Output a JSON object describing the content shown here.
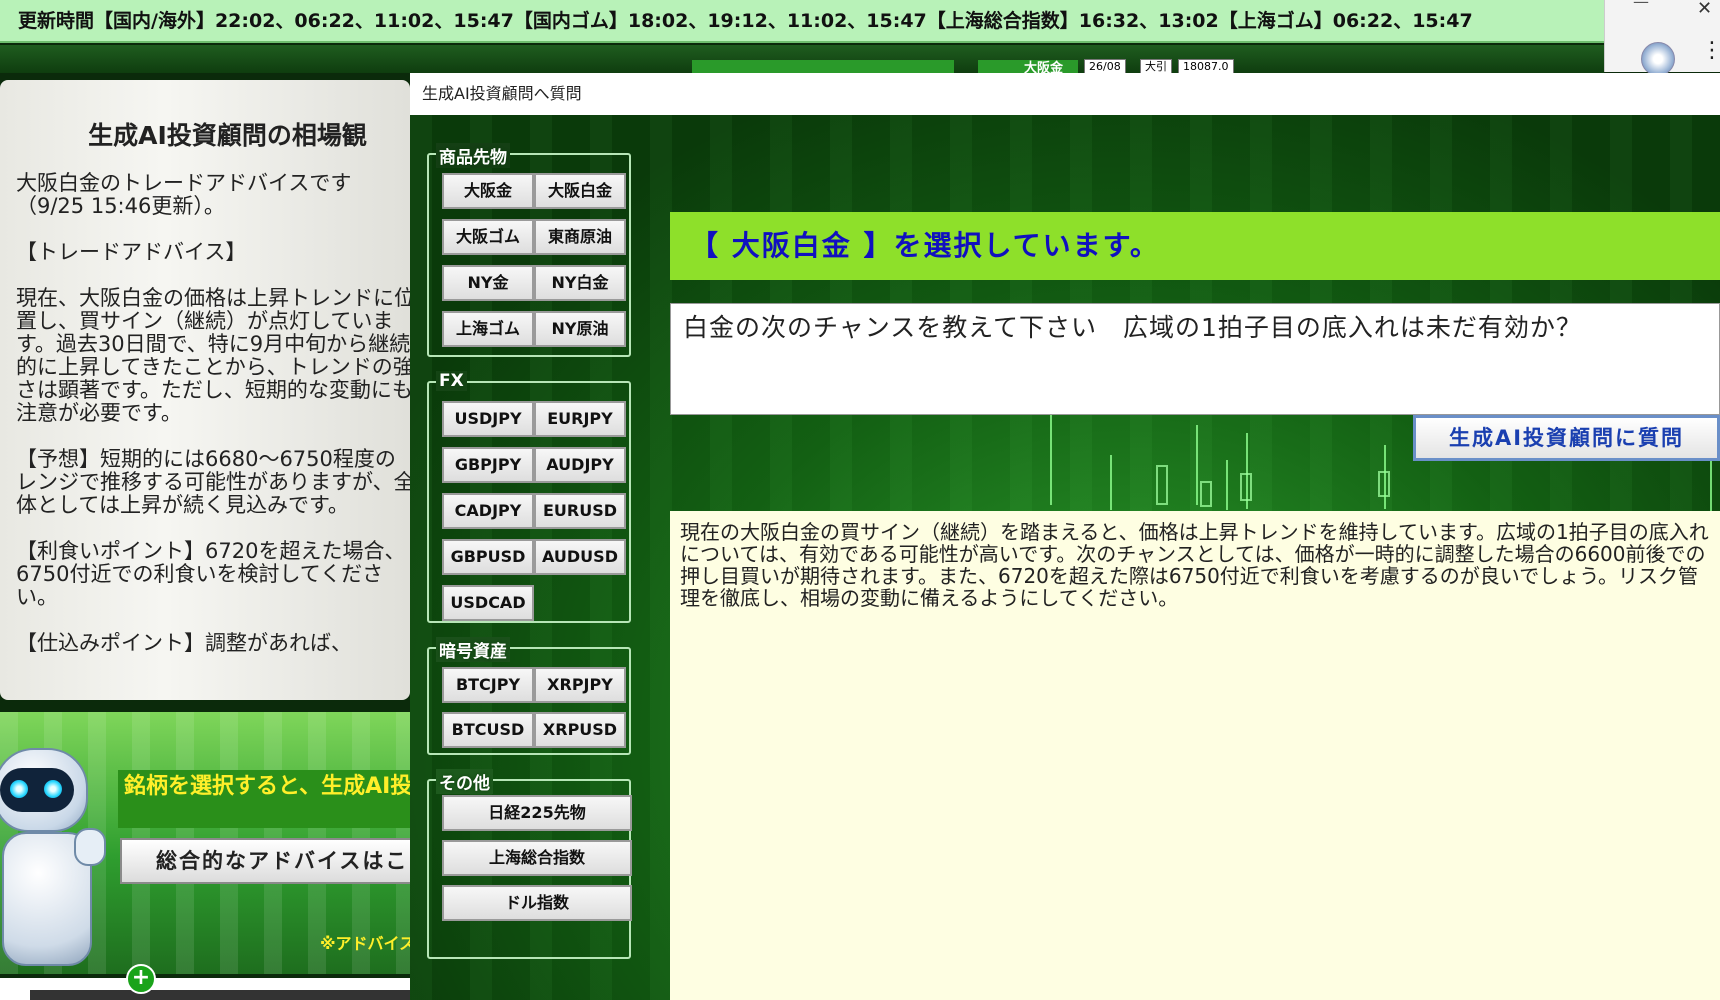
{
  "ticker": {
    "text": "更新時間【国内/海外】22:02、06:22、11:02、15:47【国内ゴム】18:02、19:12、11:02、15:47【上海総合指数】16:32、13:02【上海ゴム】06:22、15:47"
  },
  "background_app": {
    "quote_label": "大阪金",
    "quote_cells": [
      "26/08",
      "大引",
      "18087.0"
    ],
    "left_panel": {
      "title": "生成AI投資顧問の相場観",
      "body": "大阪白金のトレードアドバイスです（9/25 15:46更新）。\n\n【トレードアドバイス】\n\n現在、大阪白金の価格は上昇トレンドに位置し、買サイン（継続）が点灯しています。過去30日間で、特に9月中旬から継続的に上昇してきたことから、トレンドの強さは顕著です。ただし、短期的な変動にも注意が必要です。\n\n【予想】短期的には6680〜6750程度のレンジで推移する可能性がありますが、全体としては上昇が続く見込みです。\n\n【利食いポイント】6720を超えた場合、6750付近での利食いを検討してください。\n\n【仕込みポイント】調整があれば、"
    },
    "yellow_message": "銘柄を選択すると、生成AI投資顧問からのアドバイスが表示されます。",
    "overall_button": "総合的なアドバイスはこちら",
    "note": "※アドバイス"
  },
  "dialog": {
    "title": "生成AI投資顧問へ質問",
    "groups": {
      "commodities": {
        "label": "商品先物",
        "buttons": [
          "大阪金",
          "大阪白金",
          "大阪ゴム",
          "東商原油",
          "NY金",
          "NY白金",
          "上海ゴム",
          "NY原油"
        ]
      },
      "fx": {
        "label": "FX",
        "buttons": [
          "USDJPY",
          "EURJPY",
          "GBPJPY",
          "AUDJPY",
          "CADJPY",
          "EURUSD",
          "GBPUSD",
          "AUDUSD",
          "USDCAD"
        ]
      },
      "crypto": {
        "label": "暗号資産",
        "buttons": [
          "BTCJPY",
          "XRPJPY",
          "BTCUSD",
          "XRPUSD"
        ]
      },
      "other": {
        "label": "その他",
        "buttons": [
          "日経225先物",
          "上海総合指数",
          "ドル指数"
        ]
      }
    },
    "selected_banner": "【 大阪白金 】を選択しています。",
    "question_value": "白金の次のチャンスを教えて下さい　広域の1拍子目の底入れは未だ有効か？",
    "ask_button": "生成AI投資顧問に質問",
    "answer": "現在の大阪白金の買サイン（継続）を踏まえると、価格は上昇トレンドを維持しています。広域の1拍子目の底入れについては、有効である可能性が高いです。次のチャンスとしては、価格が一時的に調整した場合の6600前後での押し目買いが期待されます。また、6720を超えた際は6750付近で利食いを考慮するのが良いでしょう。リスク管理を徹底し、相場の変動に備えるようにしてください。"
  },
  "colors": {
    "accent_green": "#8ee02a",
    "banner_text_blue": "#1010c0",
    "answer_bg": "#fefee2",
    "ticker_bg": "#b8f2b8"
  }
}
